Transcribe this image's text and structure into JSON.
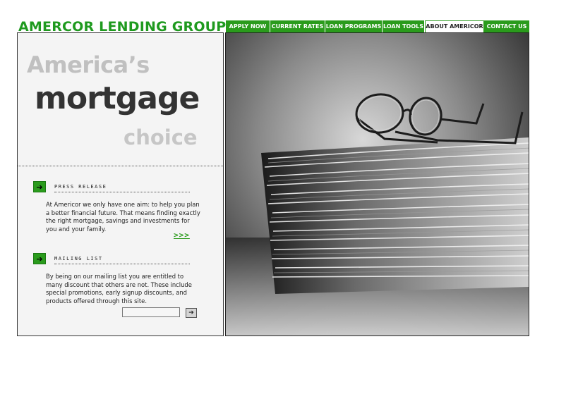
{
  "brand": {
    "logo_text": "AMERCOR LENDING GROUP"
  },
  "nav": {
    "items": [
      {
        "label": "APPLY NOW"
      },
      {
        "label": "CURRENT RATES"
      },
      {
        "label": "LOAN PROGRAMS"
      },
      {
        "label": "LOAN TOOLS"
      },
      {
        "label": "ABOUT AMERICOR",
        "active": true
      },
      {
        "label": "CONTACT US"
      }
    ]
  },
  "hero": {
    "line1": "America’s",
    "line2": "mortgage",
    "line3": "choice"
  },
  "press_release": {
    "title": "PRESS RELEASE",
    "body": "At Americor we only have one aim: to help you plan a better financial future. That means finding exactly the right mortgage, savings and investments for you and your family.",
    "more_label": ">>>"
  },
  "mailing_list": {
    "title": "MAILING LIST",
    "body": "By being on our mailing list you are entitled to many discount that others are not. These include special promotions, early signup discounts, and products offered through this site.",
    "input_value": "",
    "submit_icon": "arrow-right-icon"
  },
  "colors": {
    "brand_green": "#2a9b1c",
    "panel_bg": "#f4f4f4",
    "hero_dark": "#333333",
    "hero_light": "#c0c0c0"
  },
  "photo": {
    "subject": "stack-of-papers-with-glasses"
  }
}
